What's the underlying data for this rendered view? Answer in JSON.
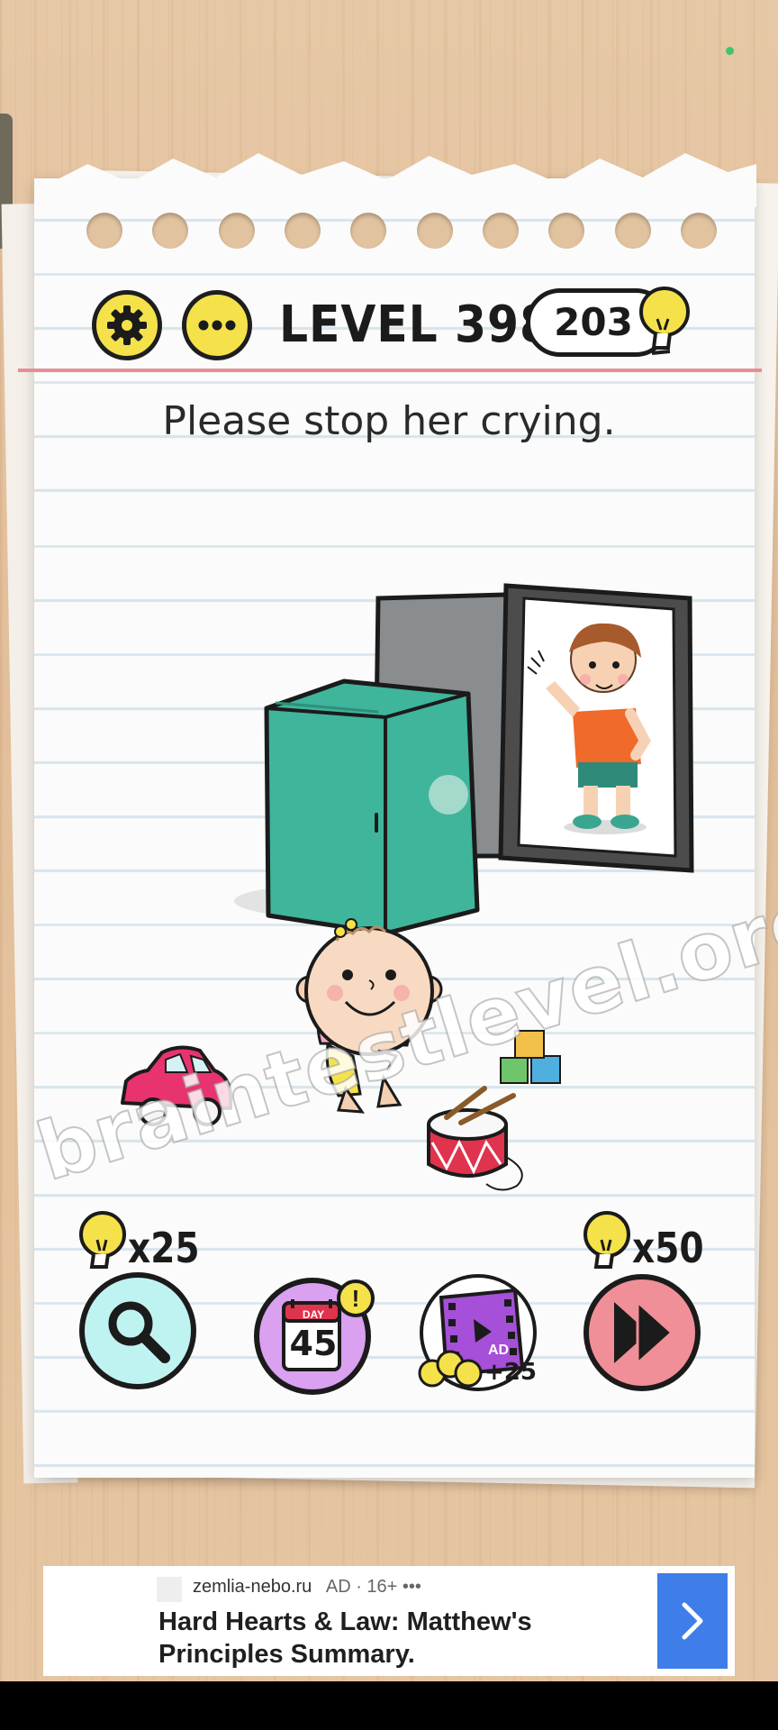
{
  "header": {
    "settings_icon": "gear-icon",
    "menu_icon": "more-dots-icon",
    "level_label": "LEVEL 398",
    "hint_count": "203",
    "hint_icon": "lightbulb-icon"
  },
  "question": "Please stop her crying.",
  "watermark": "braintestlevel.org",
  "tools": {
    "search_cost": "x25",
    "skip_cost": "x50",
    "daily_day_label": "DAY",
    "daily_day_number": "45",
    "daily_badge": "!",
    "video_ad_label": "AD",
    "video_reward": "+25"
  },
  "ad": {
    "domain": "zemlia-nebo.ru",
    "badge": "AD · 16+ •••",
    "title": "Hard Hearts & Law: Matthew's Principles Summary."
  },
  "colors": {
    "accent_yellow": "#f5e24a",
    "fridge_green": "#3fb59b",
    "search_bg": "#bff3f1",
    "daily_bg": "#d9a1ef",
    "skip_bg": "#f08f97",
    "ad_arrow": "#3f7ee8"
  }
}
